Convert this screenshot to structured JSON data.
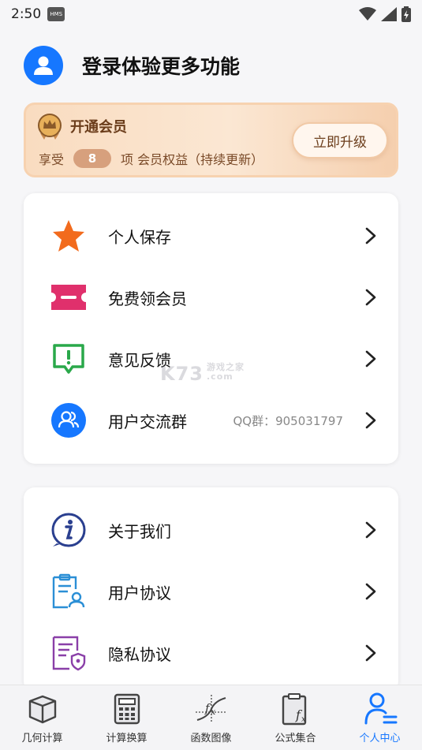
{
  "status_bar": {
    "time": "2:50",
    "badge": "HMS"
  },
  "profile": {
    "title": "登录体验更多功能"
  },
  "vip": {
    "title": "开通会员",
    "prefix": "享受",
    "count": "8",
    "suffix": "项 会员权益（持续更新）",
    "button": "立即升级",
    "colors": {
      "accent": "#6b3d1b",
      "badge": "#d7a07d"
    }
  },
  "menu_group_1": [
    {
      "label": "个人保存",
      "icon": "star-icon"
    },
    {
      "label": "免费领会员",
      "icon": "ticket-icon"
    },
    {
      "label": "意见反馈",
      "icon": "feedback-icon"
    },
    {
      "label": "用户交流群",
      "icon": "group-icon",
      "extra": "QQ群：905031797"
    }
  ],
  "menu_group_2": [
    {
      "label": "关于我们",
      "icon": "info-icon"
    },
    {
      "label": "用户协议",
      "icon": "user-agreement-icon"
    },
    {
      "label": "隐私协议",
      "icon": "privacy-icon"
    }
  ],
  "tabs": [
    {
      "label": "几何计算",
      "icon": "cube-icon"
    },
    {
      "label": "计算换算",
      "icon": "calculator-icon"
    },
    {
      "label": "函数图像",
      "icon": "function-graph-icon"
    },
    {
      "label": "公式集合",
      "icon": "formula-clipboard-icon"
    },
    {
      "label": "个人中心",
      "icon": "person-icon",
      "active": true
    }
  ],
  "watermark": {
    "main": "K73",
    "sub1": "游戏之家",
    "sub2": ".com"
  },
  "colors": {
    "primary": "#1677ff",
    "background": "#f6f6f8"
  }
}
